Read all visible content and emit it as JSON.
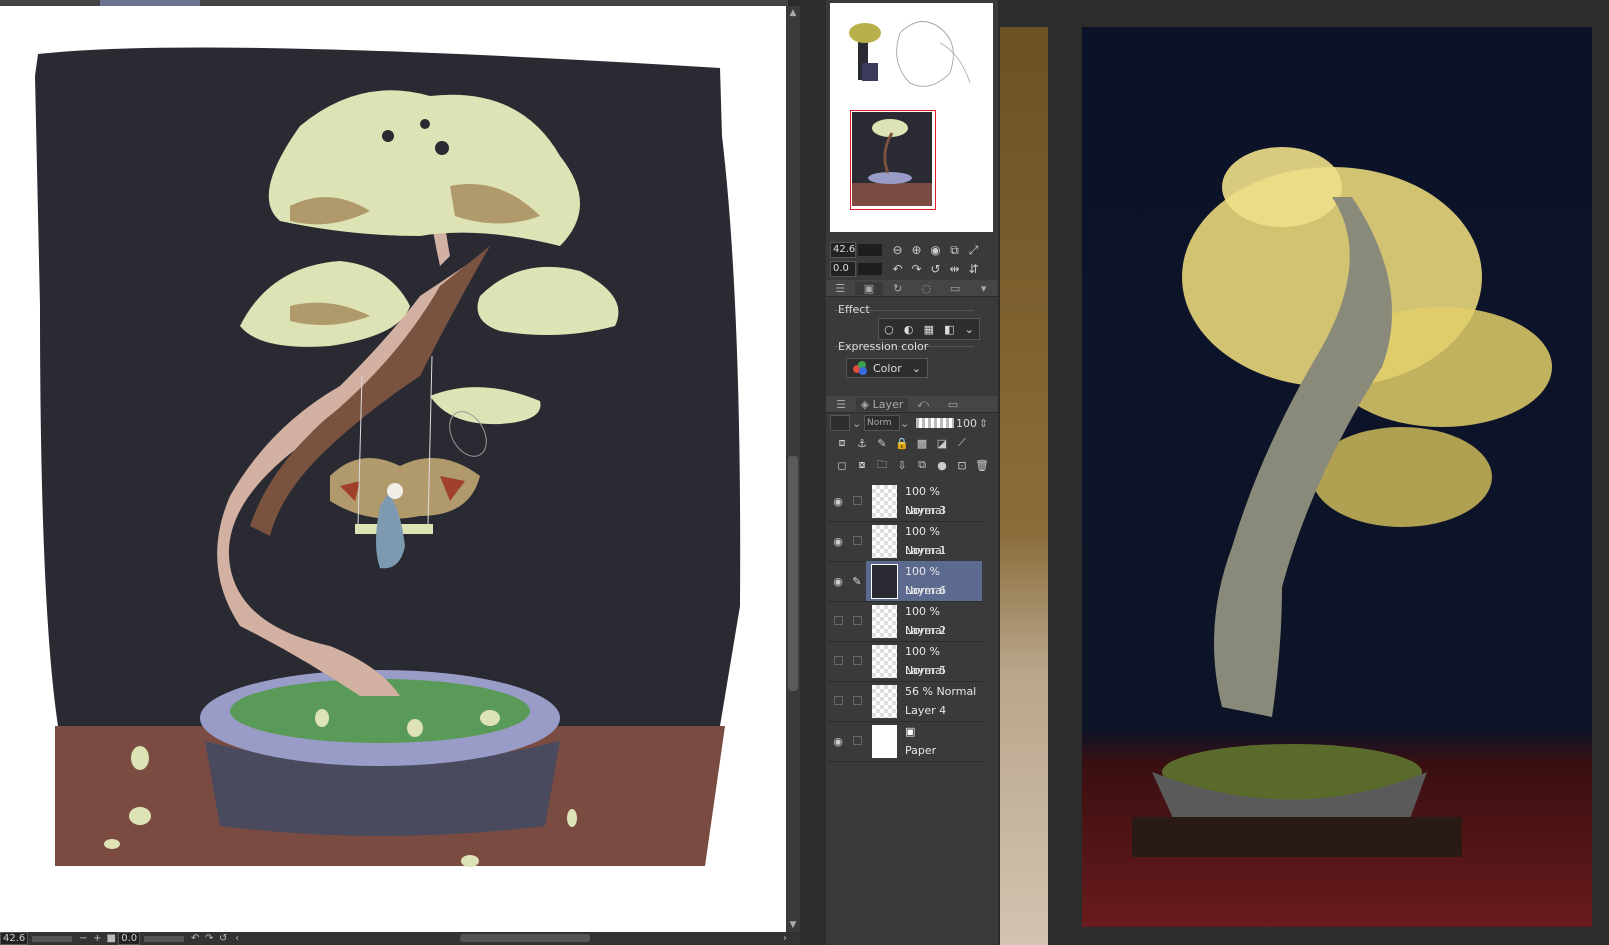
{
  "navigator": {
    "zoom_value": "42.6",
    "rotate_value": "0.0"
  },
  "sub_tool_panel": {
    "effect_label": "Effect",
    "expression_color_label": "Expression color",
    "expression_color_value": "Color"
  },
  "layer_panel": {
    "tab_label": "Layer",
    "blend_mode": "Norm",
    "opacity": "100",
    "layers": [
      {
        "blend": "100 % Normal",
        "name": "Layer 3",
        "visible": true,
        "selected": false
      },
      {
        "blend": "100 % Normal",
        "name": "Layer 1",
        "visible": true,
        "selected": false
      },
      {
        "blend": "100 % Normal",
        "name": "Layer 6",
        "visible": true,
        "selected": true
      },
      {
        "blend": "100 % Normal",
        "name": "Layer 2",
        "visible": false,
        "selected": false
      },
      {
        "blend": "100 % Normal",
        "name": "Layer 5",
        "visible": false,
        "selected": false
      },
      {
        "blend": "56 % Normal",
        "name": "Layer 4",
        "visible": false,
        "selected": false
      },
      {
        "blend": "",
        "name": "Paper",
        "visible": true,
        "selected": false
      }
    ]
  },
  "status_bar": {
    "zoom_value": "42.6",
    "rotate_value": "0.0"
  },
  "colors": {
    "selected_layer": "#5b6a8e",
    "nav_frame": "#e0202a"
  },
  "icons": [
    "eye-icon",
    "pen-icon",
    "zoom-out-icon",
    "zoom-in-icon",
    "rotate-left-icon",
    "rotate-right-icon",
    "flip-horizontal-icon",
    "flip-vertical-icon",
    "new-layer-icon",
    "folder-icon",
    "trash-icon",
    "lock-icon"
  ]
}
